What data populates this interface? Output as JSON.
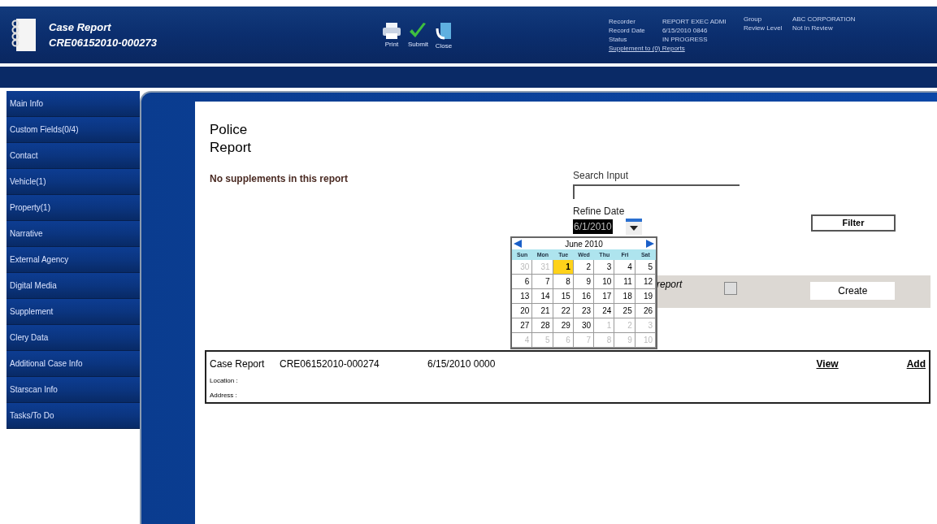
{
  "header": {
    "title": "Case Report",
    "case_number": "CRE06152010-000273",
    "toolbar": [
      {
        "kind": "print",
        "label": "Print"
      },
      {
        "kind": "submit",
        "label": "Submit"
      },
      {
        "kind": "close",
        "label": "Close"
      }
    ],
    "info_left": [
      {
        "label": "Recorder",
        "value": "REPORT EXEC ADMI"
      },
      {
        "label": "Record Date",
        "value": "6/15/2010 0846"
      },
      {
        "label": "Status",
        "value": "IN PROGRESS"
      }
    ],
    "supplement_link": "Supplement to (0) Reports",
    "info_right": [
      {
        "label": "Group",
        "value": "ABC CORPORATION"
      },
      {
        "label": "Review Level",
        "value": "Not In Review"
      }
    ]
  },
  "sidebar": {
    "items": [
      {
        "label": "Main Info"
      },
      {
        "label": "Custom Fields(0/4)"
      },
      {
        "label": "Contact"
      },
      {
        "label": "Vehicle(1)"
      },
      {
        "label": "Property(1)"
      },
      {
        "label": "Narrative"
      },
      {
        "label": "External Agency"
      },
      {
        "label": "Digital Media"
      },
      {
        "label": "Supplement"
      },
      {
        "label": "Clery Data"
      },
      {
        "label": "Additional Case Info"
      },
      {
        "label": "Starscan Info"
      },
      {
        "label": "Tasks/To Do"
      }
    ]
  },
  "content": {
    "title": "Police Report",
    "message": "No supplements in this report",
    "search": {
      "label": "Search Input"
    },
    "refine_date": {
      "label": "Refine Date",
      "value": "6/1/2010"
    },
    "filter_button": "Filter",
    "create_bar": {
      "label": "report",
      "button": "Create"
    },
    "case_row": {
      "type": "Case Report",
      "number": "CRE06152010-000274",
      "date": "6/15/2010 0000",
      "view": "View",
      "add": "Add",
      "fields": [
        "Location :",
        "Address :"
      ]
    }
  },
  "calendar": {
    "month": "June 2010",
    "weekdays": [
      "Sun",
      "Mon",
      "Tue",
      "Wed",
      "Thu",
      "Fri",
      "Sat"
    ],
    "days": [
      {
        "label": "30",
        "in_month": false,
        "selected": false
      },
      {
        "label": "31",
        "in_month": false,
        "selected": false
      },
      {
        "label": "1",
        "in_month": true,
        "selected": true
      },
      {
        "label": "2",
        "in_month": true,
        "selected": false
      },
      {
        "label": "3",
        "in_month": true,
        "selected": false
      },
      {
        "label": "4",
        "in_month": true,
        "selected": false
      },
      {
        "label": "5",
        "in_month": true,
        "selected": false
      },
      {
        "label": "6",
        "in_month": true,
        "selected": false
      },
      {
        "label": "7",
        "in_month": true,
        "selected": false
      },
      {
        "label": "8",
        "in_month": true,
        "selected": false
      },
      {
        "label": "9",
        "in_month": true,
        "selected": false
      },
      {
        "label": "10",
        "in_month": true,
        "selected": false
      },
      {
        "label": "11",
        "in_month": true,
        "selected": false
      },
      {
        "label": "12",
        "in_month": true,
        "selected": false
      },
      {
        "label": "13",
        "in_month": true,
        "selected": false
      },
      {
        "label": "14",
        "in_month": true,
        "selected": false
      },
      {
        "label": "15",
        "in_month": true,
        "selected": false
      },
      {
        "label": "16",
        "in_month": true,
        "selected": false
      },
      {
        "label": "17",
        "in_month": true,
        "selected": false
      },
      {
        "label": "18",
        "in_month": true,
        "selected": false
      },
      {
        "label": "19",
        "in_month": true,
        "selected": false
      },
      {
        "label": "20",
        "in_month": true,
        "selected": false
      },
      {
        "label": "21",
        "in_month": true,
        "selected": false
      },
      {
        "label": "22",
        "in_month": true,
        "selected": false
      },
      {
        "label": "23",
        "in_month": true,
        "selected": false
      },
      {
        "label": "24",
        "in_month": true,
        "selected": false
      },
      {
        "label": "25",
        "in_month": true,
        "selected": false
      },
      {
        "label": "26",
        "in_month": true,
        "selected": false
      },
      {
        "label": "27",
        "in_month": true,
        "selected": false
      },
      {
        "label": "28",
        "in_month": true,
        "selected": false
      },
      {
        "label": "29",
        "in_month": true,
        "selected": false
      },
      {
        "label": "30",
        "in_month": true,
        "selected": false
      },
      {
        "label": "1",
        "in_month": false,
        "selected": false
      },
      {
        "label": "2",
        "in_month": false,
        "selected": false
      },
      {
        "label": "3",
        "in_month": false,
        "selected": false
      },
      {
        "label": "4",
        "in_month": false,
        "selected": false
      },
      {
        "label": "5",
        "in_month": false,
        "selected": false
      },
      {
        "label": "6",
        "in_month": false,
        "selected": false
      },
      {
        "label": "7",
        "in_month": false,
        "selected": false
      },
      {
        "label": "8",
        "in_month": false,
        "selected": false
      },
      {
        "label": "9",
        "in_month": false,
        "selected": false
      },
      {
        "label": "10",
        "in_month": false,
        "selected": false
      }
    ]
  }
}
